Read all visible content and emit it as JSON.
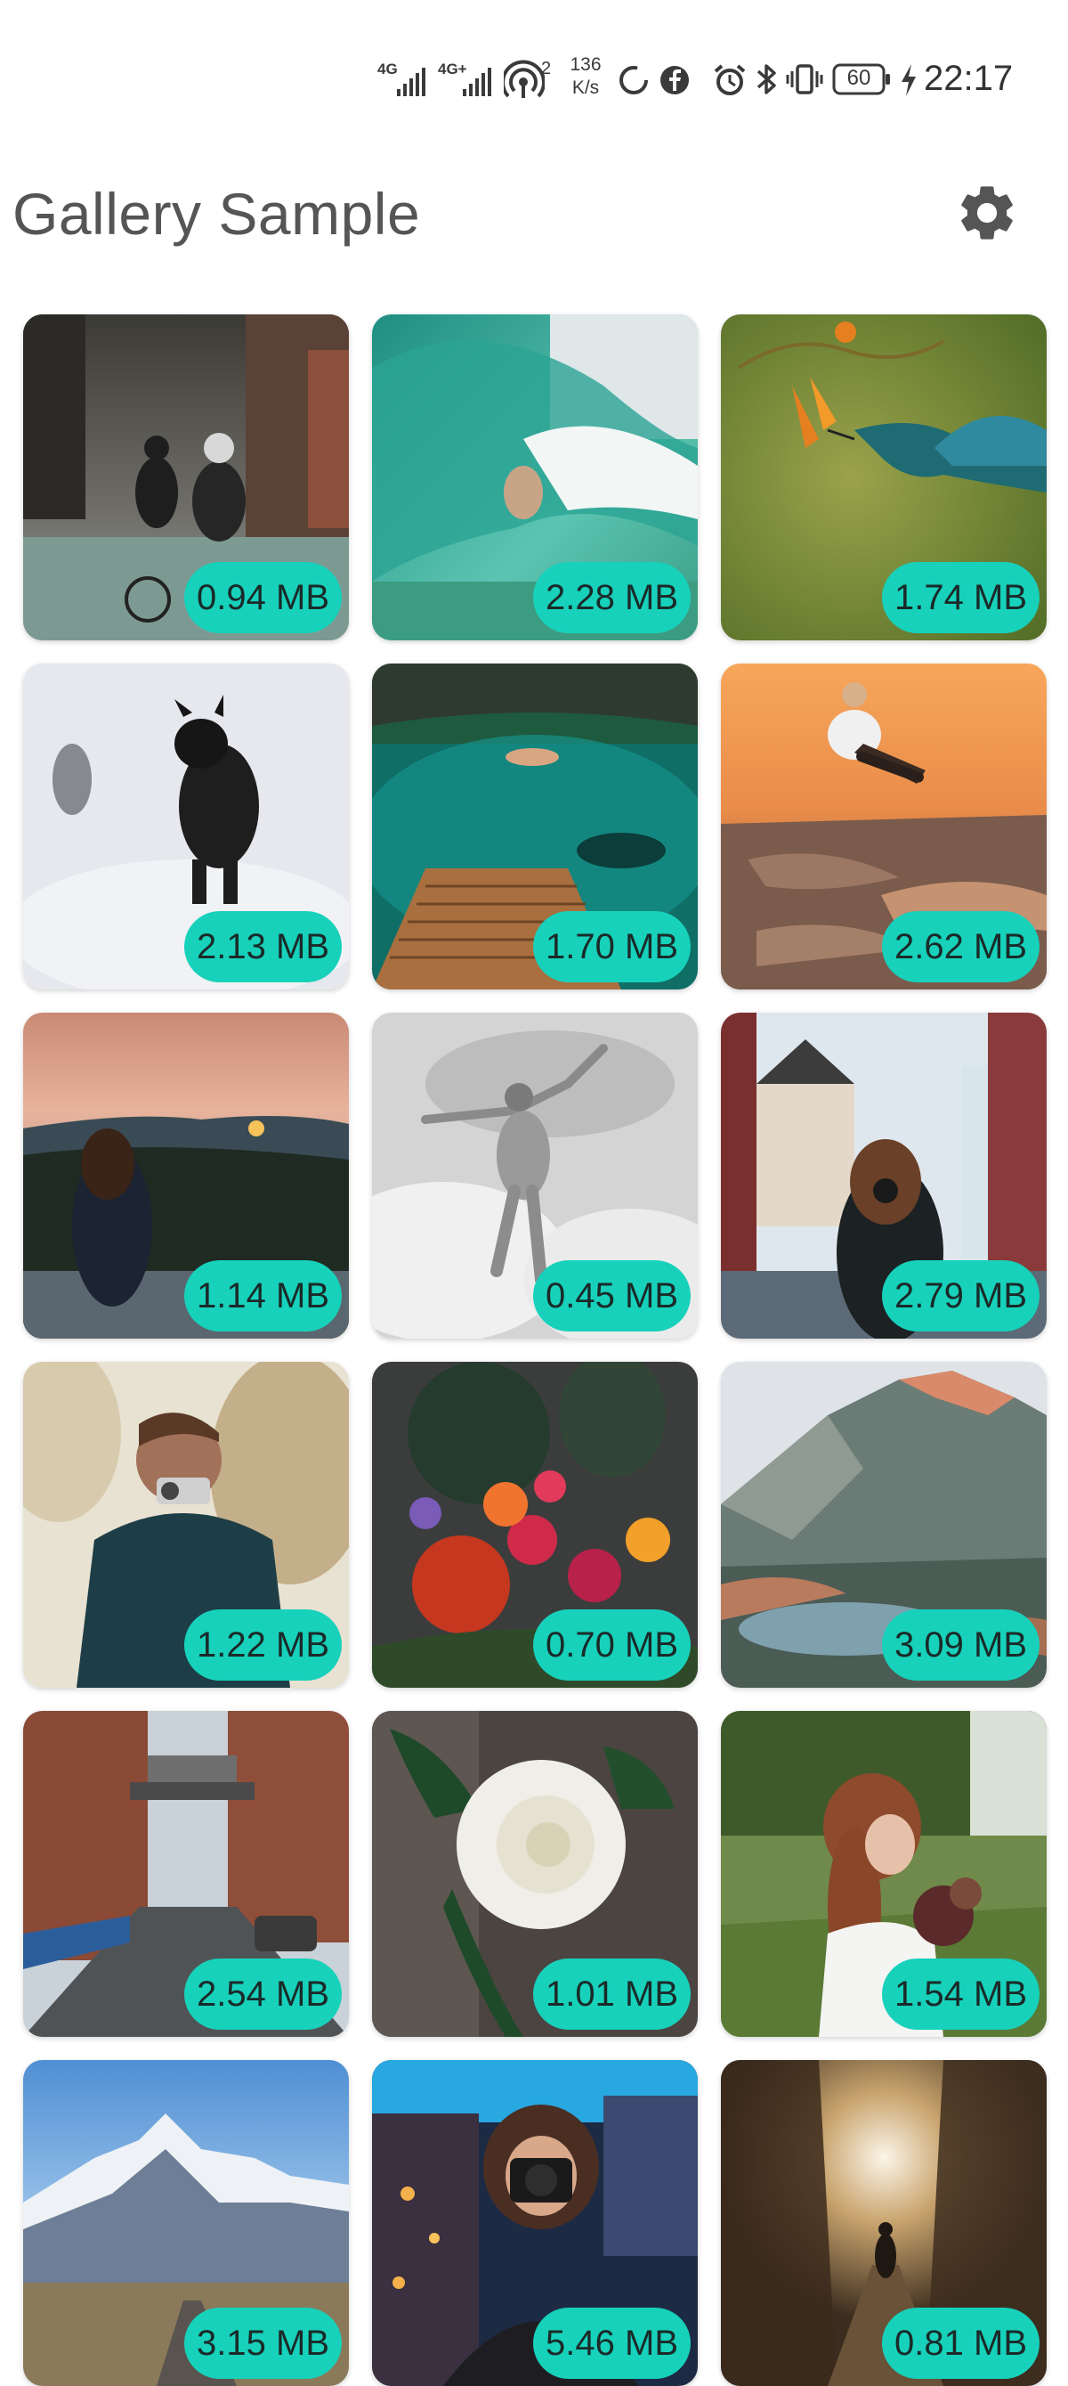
{
  "status_bar": {
    "net1": "4G",
    "net2": "4G+",
    "hotspot_count": "2",
    "speed_value": "136",
    "speed_unit": "K/s",
    "battery": "60",
    "time": "22:17"
  },
  "header": {
    "title": "Gallery Sample",
    "settings_icon": "gear-icon"
  },
  "colors": {
    "badge": "#17d1bb",
    "title": "#555555"
  },
  "photos": [
    {
      "size": "0.94 MB",
      "subject": "cyclists on city street"
    },
    {
      "size": "2.28 MB",
      "subject": "surfer in wave"
    },
    {
      "size": "1.74 MB",
      "subject": "hummingbird and flower"
    },
    {
      "size": "2.13 MB",
      "subject": "dogs running in snow"
    },
    {
      "size": "1.70 MB",
      "subject": "person diving into lagoon"
    },
    {
      "size": "2.62 MB",
      "subject": "skateboarder at sunset"
    },
    {
      "size": "1.14 MB",
      "subject": "woman photographing sunset"
    },
    {
      "size": "0.45 MB",
      "subject": "man jumping in clouds"
    },
    {
      "size": "2.79 MB",
      "subject": "woman with camera on street"
    },
    {
      "size": "1.22 MB",
      "subject": "boy with camera"
    },
    {
      "size": "0.70 MB",
      "subject": "flower bouquet"
    },
    {
      "size": "3.09 MB",
      "subject": "mountain lake"
    },
    {
      "size": "2.54 MB",
      "subject": "city street with bridge"
    },
    {
      "size": "1.01 MB",
      "subject": "white rose"
    },
    {
      "size": "1.54 MB",
      "subject": "bride with bouquet"
    },
    {
      "size": "3.15 MB",
      "subject": "snowy mountains"
    },
    {
      "size": "5.46 MB",
      "subject": "woman with camera at night"
    },
    {
      "size": "0.81 MB",
      "subject": "person in forest light"
    }
  ]
}
